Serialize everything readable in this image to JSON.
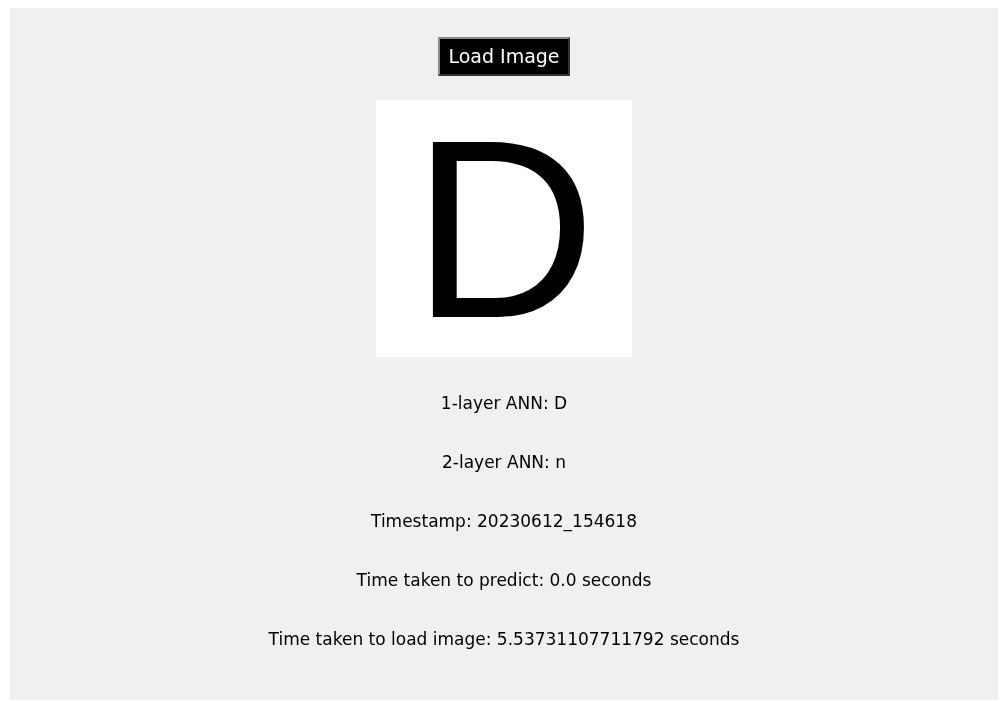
{
  "button": {
    "label": "Load Image"
  },
  "image": {
    "letter": "D"
  },
  "results": [
    "1-layer ANN: D",
    "2-layer ANN: n",
    "Timestamp: 20230612_154618",
    "Time taken to predict: 0.0 seconds",
    "Time taken to load image: 5.53731107711792 seconds"
  ]
}
